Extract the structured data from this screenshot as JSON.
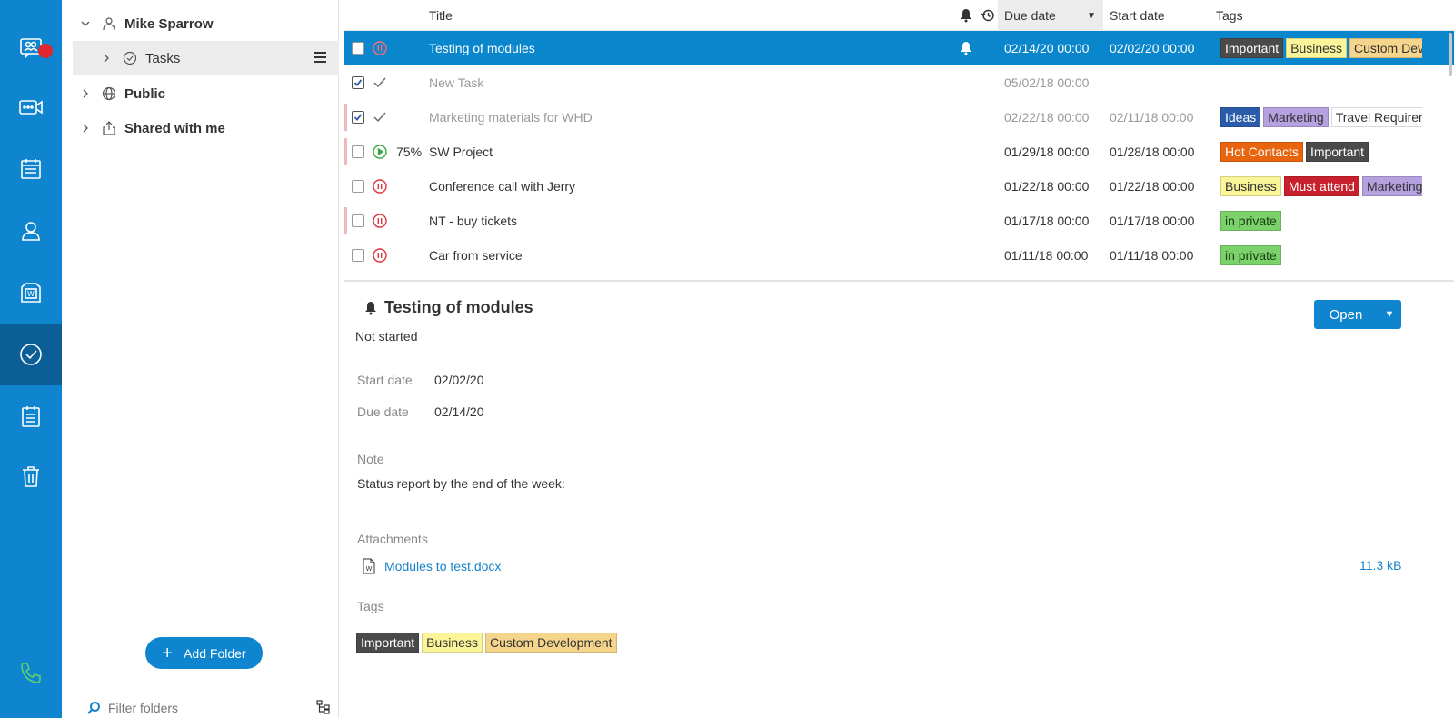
{
  "rail": {
    "items": [
      {
        "icon": "chat-group-icon",
        "badge": true
      },
      {
        "icon": "video-chat-icon"
      },
      {
        "icon": "calendar-icon"
      },
      {
        "icon": "contacts-icon"
      },
      {
        "icon": "documents-icon"
      },
      {
        "icon": "tasks-icon",
        "active": true
      },
      {
        "icon": "notes-icon"
      },
      {
        "icon": "trash-icon"
      }
    ],
    "phone_icon": "phone-icon"
  },
  "folders": {
    "owner": "Mike Sparrow",
    "tasks": "Tasks",
    "public": "Public",
    "shared": "Shared with me",
    "add_folder": "Add Folder",
    "filter_placeholder": "Filter folders"
  },
  "tasklist": {
    "headers": {
      "title": "Title",
      "due": "Due date",
      "start": "Start date",
      "tags": "Tags"
    },
    "rows": [
      {
        "title": "Testing of modules",
        "status": "paused",
        "progress": "",
        "reminder": true,
        "due": "02/14/20 00:00",
        "start": "02/02/20 00:00",
        "tags": [
          "Important",
          "Business",
          "Custom Development"
        ],
        "selected": true,
        "checked": false,
        "priority": false
      },
      {
        "title": "New Task",
        "status": "done",
        "progress": "",
        "reminder": false,
        "due": "05/02/18 00:00",
        "start": "",
        "tags": [],
        "selected": false,
        "checked": true,
        "priority": false
      },
      {
        "title": "Marketing materials for WHD",
        "status": "done",
        "progress": "",
        "reminder": false,
        "due": "02/22/18 00:00",
        "start": "02/11/18 00:00",
        "tags": [
          "Ideas",
          "Marketing",
          "Travel Requirements"
        ],
        "selected": false,
        "checked": true,
        "priority": true
      },
      {
        "title": "SW Project",
        "status": "in-progress",
        "progress": "75%",
        "reminder": false,
        "due": "01/29/18 00:00",
        "start": "01/28/18 00:00",
        "tags": [
          "Hot Contacts",
          "Important"
        ],
        "selected": false,
        "checked": false,
        "priority": true
      },
      {
        "title": "Conference call with Jerry",
        "status": "paused",
        "progress": "",
        "reminder": false,
        "due": "01/22/18 00:00",
        "start": "01/22/18 00:00",
        "tags": [
          "Business",
          "Must attend",
          "Marketing"
        ],
        "selected": false,
        "checked": false,
        "priority": false
      },
      {
        "title": "NT - buy tickets",
        "status": "paused",
        "progress": "",
        "reminder": false,
        "due": "01/17/18 00:00",
        "start": "01/17/18 00:00",
        "tags": [
          "in private"
        ],
        "selected": false,
        "checked": false,
        "priority": true
      },
      {
        "title": "Car from service",
        "status": "paused",
        "progress": "",
        "reminder": false,
        "due": "01/11/18 00:00",
        "start": "01/11/18 00:00",
        "tags": [
          "in private"
        ],
        "selected": false,
        "checked": false,
        "priority": false
      }
    ]
  },
  "tag_colors": {
    "Important": {
      "bg": "#4a4a4a",
      "fg": "#ffffff"
    },
    "Business": {
      "bg": "#fbf59a",
      "fg": "#333333"
    },
    "Custom Development": {
      "bg": "#f5d58b",
      "fg": "#333333"
    },
    "Ideas": {
      "bg": "#2a5caa",
      "fg": "#ffffff"
    },
    "Marketing": {
      "bg": "#b5a0e0",
      "fg": "#333333"
    },
    "Travel Requirements": {
      "bg": "#ffffff",
      "fg": "#333333"
    },
    "Hot Contacts": {
      "bg": "#e8650d",
      "fg": "#ffffff"
    },
    "Must attend": {
      "bg": "#c8202c",
      "fg": "#ffffff"
    },
    "in private": {
      "bg": "#7bd16a",
      "fg": "#1a3d12"
    }
  },
  "detail": {
    "title": "Testing of modules",
    "status": "Not started",
    "open_label": "Open",
    "start_label": "Start date",
    "start_value": "02/02/20",
    "due_label": "Due date",
    "due_value": "02/14/20",
    "note_label": "Note",
    "note_value": "Status report by the end of the week:",
    "attachments_label": "Attachments",
    "attachment_name": "Modules to test.docx",
    "attachment_size": "11.3 kB",
    "tags_label": "Tags",
    "tags": [
      "Important",
      "Business",
      "Custom Development"
    ]
  }
}
